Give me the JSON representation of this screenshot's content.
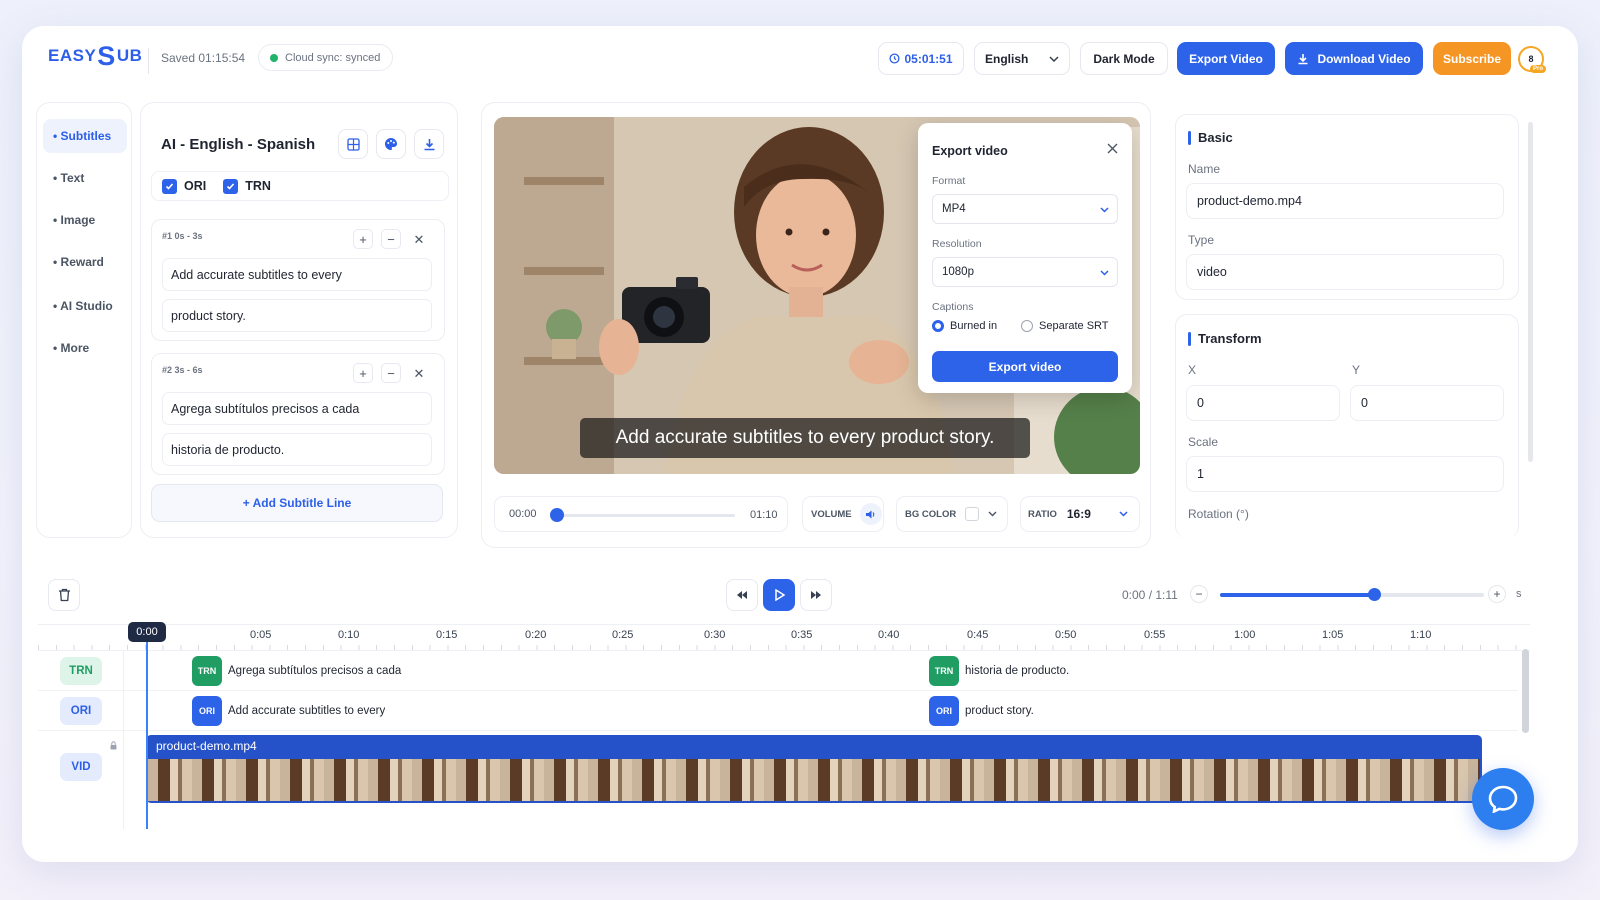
{
  "topbar": {
    "logo_left": "EASY",
    "logo_s": "S",
    "logo_right": "UB",
    "saved": "Saved 01:15:54",
    "sync": "Cloud sync: synced",
    "timer": "05:01:51",
    "language": "English",
    "dark_mode": "Dark Mode",
    "export_video": "Export Video",
    "download_video": "Download Video",
    "subscribe": "Subscribe",
    "avatar_count": "8",
    "pro": "Pro"
  },
  "sidebar": {
    "items": [
      {
        "label": "• Subtitles"
      },
      {
        "label": "• Text"
      },
      {
        "label": "• Image"
      },
      {
        "label": "• Reward"
      },
      {
        "label": "• AI Studio"
      },
      {
        "label": "• More"
      }
    ]
  },
  "subtitles": {
    "title": "AI - English - Spanish",
    "ori_label": "ORI",
    "trn_label": "TRN",
    "lines": [
      {
        "header": "#1   0s - 3s",
        "original": "Add accurate subtitles to every",
        "translation": "product story."
      },
      {
        "header": "#2   3s - 6s",
        "original": "Agrega subtítulos precisos a cada",
        "translation": "historia de producto."
      }
    ],
    "add_line": "+ Add Subtitle Line"
  },
  "player": {
    "caption": "Add accurate subtitles to every product story.",
    "time_start": "00:00",
    "time_end": "01:10",
    "volume_label": "VOLUME",
    "bgcolor_label": "BG COLOR",
    "ratio_label": "RATIO",
    "ratio_value": "16:9"
  },
  "export_modal": {
    "title": "Export video",
    "format_label": "Format",
    "format_value": "MP4",
    "resolution_label": "Resolution",
    "resolution_value": "1080p",
    "captions_label": "Captions",
    "option_burned": "Burned in",
    "option_srt": "Separate SRT",
    "export_button": "Export video"
  },
  "properties": {
    "basic_title": "Basic",
    "name_label": "Name",
    "name_value": "product-demo.mp4",
    "type_label": "Type",
    "type_value": "video",
    "transform_title": "Transform",
    "x_label": "X",
    "x_value": "0",
    "y_label": "Y",
    "y_value": "0",
    "scale_label": "Scale",
    "scale_value": "1",
    "rotation_label": "Rotation (°)"
  },
  "timeline": {
    "time_display": "0:00 / 1:11",
    "zoom_unit": "s",
    "playhead": "0:00",
    "ticks": [
      "0:05",
      "0:10",
      "0:15",
      "0:20",
      "0:25",
      "0:30",
      "0:35",
      "0:40",
      "0:45",
      "0:50",
      "0:55",
      "1:00",
      "1:05",
      "1:10"
    ],
    "tracks": {
      "trn": "TRN",
      "ori": "ORI",
      "vid": "VID"
    },
    "trn_clips": [
      "Agrega subtítulos precisos a cada",
      "historia de producto."
    ],
    "ori_clips": [
      "Add accurate subtitles to every",
      "product story."
    ],
    "video_clip": "product-demo.mp4"
  },
  "colors": {
    "accent": "#2d63e8",
    "orange": "#f59524",
    "green": "#1f9d63",
    "video_track": "#2552c9"
  }
}
